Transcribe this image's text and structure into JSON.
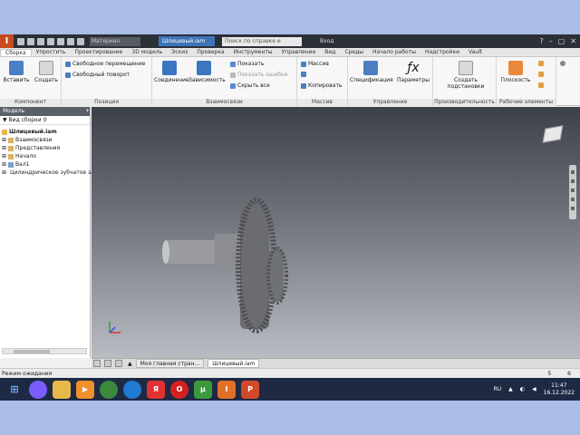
{
  "titlebar": {
    "material": "Материал",
    "document_tab": "Шлицевый.iam",
    "search_placeholder": "Поиск по справке и командам",
    "user": "Вход",
    "help": "?"
  },
  "ribbon_tabs": [
    "Сборка",
    "Упростить",
    "Проектирование",
    "3D модель",
    "Эскиз",
    "Проверка",
    "Инструменты",
    "Управление",
    "Вид",
    "Среды",
    "Начало работы",
    "Надстройки",
    "Vault"
  ],
  "ribbon": {
    "panels": [
      {
        "title": "Компонент",
        "buttons": [
          "Вставить",
          "Создать"
        ]
      },
      {
        "title": "Позиция",
        "buttons": [
          "Свободное перемещение",
          "Свободный поворот"
        ]
      },
      {
        "title": "Взаимосвязи",
        "buttons": [
          "Соединение",
          "Зависимость",
          "Показать",
          "Показать ошибки",
          "Скрыть все"
        ]
      },
      {
        "title": "Массив",
        "buttons": [
          "Массив",
          "Копировать"
        ]
      },
      {
        "title": "Управление",
        "buttons": [
          "Спецификация",
          "Параметры"
        ]
      },
      {
        "title": "Производительность",
        "buttons": [
          "Создать подстановки"
        ]
      },
      {
        "title": "Рабочие элементы",
        "buttons": [
          "Плоскость"
        ]
      }
    ]
  },
  "browser": {
    "header": "Модель",
    "view_label": "Вид сборки",
    "tree": [
      "Шлицевый.iam",
      "Взаимосвязи",
      "Представления",
      "Начало",
      "Вал1",
      "Цилиндрическое зубчатое зацепление"
    ]
  },
  "doc_tabs": [
    "Моя главная стран...",
    "Шлицевый.iam"
  ],
  "status": {
    "text": "Режим ожидания",
    "count1": "5",
    "count2": "6"
  },
  "taskbar": {
    "lang": "RU",
    "time": "11:47",
    "date": "16.12.2022"
  }
}
